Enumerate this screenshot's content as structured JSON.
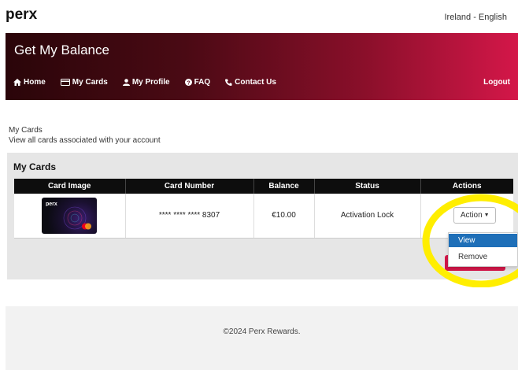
{
  "header": {
    "logo_text": "perx",
    "locale": "Ireland - English"
  },
  "banner": {
    "title": "Get My Balance",
    "nav": [
      {
        "label": "Home",
        "icon": "home-icon"
      },
      {
        "label": "My Cards",
        "icon": "credit-card-icon"
      },
      {
        "label": "My Profile",
        "icon": "user-icon"
      },
      {
        "label": "FAQ",
        "icon": "question-circle-icon"
      },
      {
        "label": "Contact Us",
        "icon": "phone-icon"
      }
    ],
    "logout": "Logout"
  },
  "intro": {
    "heading": "My Cards",
    "subtitle": "View all cards associated with your account"
  },
  "panel": {
    "title": "My Cards",
    "columns": [
      "Card Image",
      "Card Number",
      "Balance",
      "Status",
      "Actions"
    ],
    "rows": [
      {
        "card_logo": "perx",
        "card_number": "**** **** **** 8307",
        "balance": "€10.00",
        "status": "Activation Lock",
        "action_label": "Action"
      }
    ]
  },
  "dropdown": {
    "items": [
      "View",
      "Remove"
    ],
    "selected": "View"
  },
  "footer": {
    "copyright": "©2024 Perx Rewards."
  },
  "colors": {
    "brand_red": "#d41749",
    "banner_dark": "#2a0509",
    "dropdown_active": "#1e6fb8",
    "highlight_yellow": "#ffee00"
  }
}
